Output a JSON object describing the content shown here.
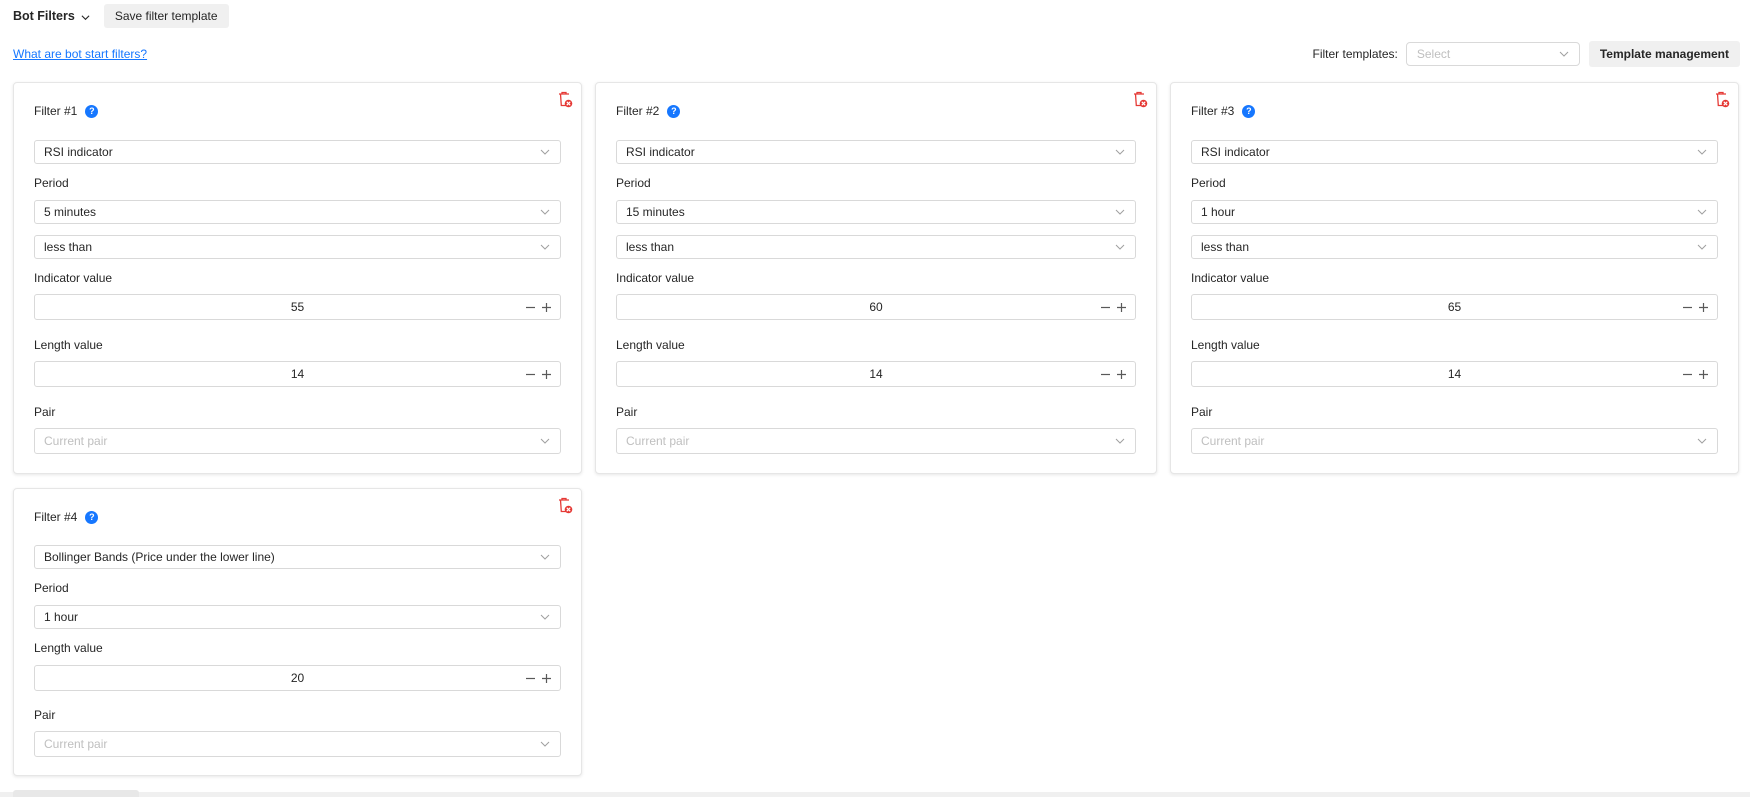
{
  "header": {
    "title": "Bot Filters",
    "save_template_label": "Save filter template",
    "help_link": "What are bot start filters?",
    "templates_label": "Filter templates:",
    "templates_placeholder": "Select",
    "template_management_label": "Template management"
  },
  "icons": {
    "trash": "trash-delete-icon",
    "help": "question-circle-icon",
    "chevron": "chevron-down-icon",
    "minus": "minus-icon",
    "plus": "plus-icon"
  },
  "colors": {
    "accent": "#1677ff",
    "danger": "#e53935",
    "border": "#d9d9d9"
  },
  "labels": {
    "period": "Period",
    "indicator_value": "Indicator value",
    "length_value": "Length value",
    "pair": "Pair",
    "pair_placeholder": "Current pair",
    "help_glyph": "?"
  },
  "filters": [
    {
      "title": "Filter #1",
      "indicator": "RSI indicator",
      "period": "5 minutes",
      "condition": "less than",
      "indicator_value": "55",
      "length_value": "14"
    },
    {
      "title": "Filter #2",
      "indicator": "RSI indicator",
      "period": "15 minutes",
      "condition": "less than",
      "indicator_value": "60",
      "length_value": "14"
    },
    {
      "title": "Filter #3",
      "indicator": "RSI indicator",
      "period": "1 hour",
      "condition": "less than",
      "indicator_value": "65",
      "length_value": "14"
    },
    {
      "title": "Filter #4",
      "indicator": "Bollinger Bands (Price under the lower line)",
      "period": "1 hour",
      "length_value": "20"
    }
  ]
}
